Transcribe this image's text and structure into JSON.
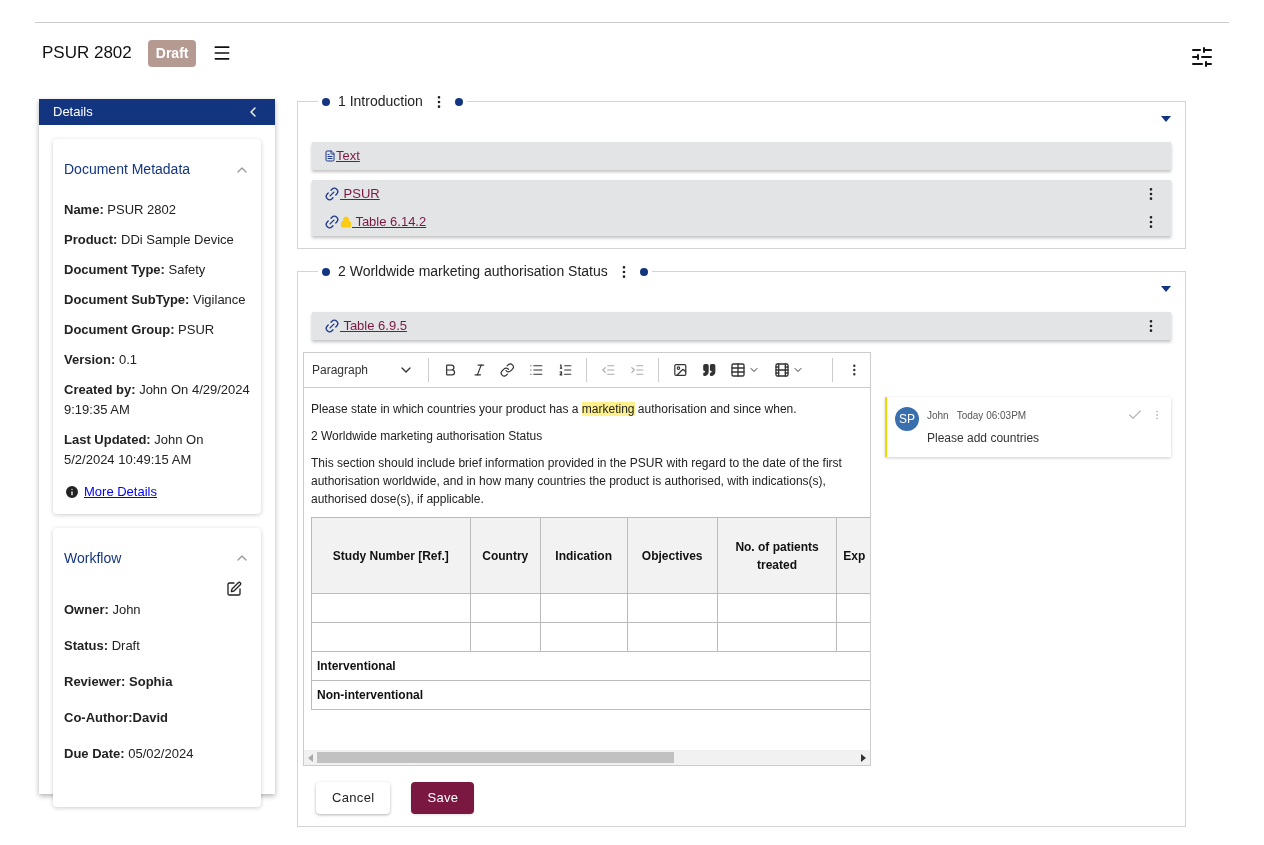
{
  "header": {
    "title": "PSUR 2802",
    "status_badge": "Draft"
  },
  "sidebar": {
    "title": "Details",
    "cards": [
      {
        "title": "Document Metadata",
        "expanded": true,
        "editable": false,
        "fields": [
          "**Name:** PSUR 2802",
          "**Product:** DDi Sample Device",
          "**Document Type:** Safety",
          "**Document SubType:** Vigilance",
          "**Document Group:** PSUR",
          "**Version:** 0.1",
          "**Created by:** John On 4/29/2024 9:19:35 AM",
          "**Last Updated:** John On 5/2/2024 10:49:15 AM"
        ],
        "link": "More Details"
      },
      {
        "title": "Workflow",
        "expanded": true,
        "editable": true,
        "fields": [
          "**Owner:** John",
          "**Status:** Draft",
          "**Reviewer: Sophia**",
          "**Co-Author:David**",
          "**Due Date:** 05/02/2024"
        ]
      }
    ]
  },
  "sections": [
    {
      "title": "1 Introduction",
      "expanded": true,
      "groups": [
        [
          {
            "kind": "text",
            "label": "Text",
            "locked": false,
            "menu": false
          }
        ],
        [
          {
            "kind": "link",
            "label": " PSUR",
            "locked": false,
            "menu": true
          },
          {
            "kind": "link",
            "label": " Table 6.14.2",
            "locked": true,
            "menu": true
          }
        ]
      ]
    },
    {
      "title": "2 Worldwide marketing authorisation Status",
      "expanded": true,
      "groups": [
        [
          {
            "kind": "link",
            "label": " Table 6.9.5",
            "locked": false,
            "menu": true
          }
        ]
      ],
      "editor": {
        "block_format": "Paragraph",
        "paragraphs": [
          [
            {
              "text": "Please state in which countries your product has a ",
              "highlighted": false
            },
            {
              "text": "marketing",
              "highlighted": true
            },
            {
              "text": " authorisation and since when.",
              "highlighted": false
            }
          ],
          [
            {
              "text": "2 Worldwide marketing authorisation Status",
              "highlighted": false
            }
          ],
          [
            {
              "text": "This section should include brief information provided in the PSUR with regard to the date of the first authorisation worldwide, and in how many countries the product is authorised, with indications(s), authorised dose(s), if applicable.",
              "highlighted": false
            }
          ]
        ],
        "table": {
          "columns": [
            "Study Number [Ref.]",
            "Country",
            "Indication",
            "Objectives",
            "No. of patients treated",
            "Exp"
          ],
          "group_rows": [
            "Interventional",
            "Non-interventional"
          ]
        }
      },
      "comment": {
        "initials": "SP",
        "author": "John",
        "time": "Today 06:03PM",
        "text": "Please add countries",
        "resolved": false
      }
    }
  ],
  "buttons": [
    {
      "label": "Cancel",
      "primary": false
    },
    {
      "label": "Save",
      "primary": true
    }
  ]
}
